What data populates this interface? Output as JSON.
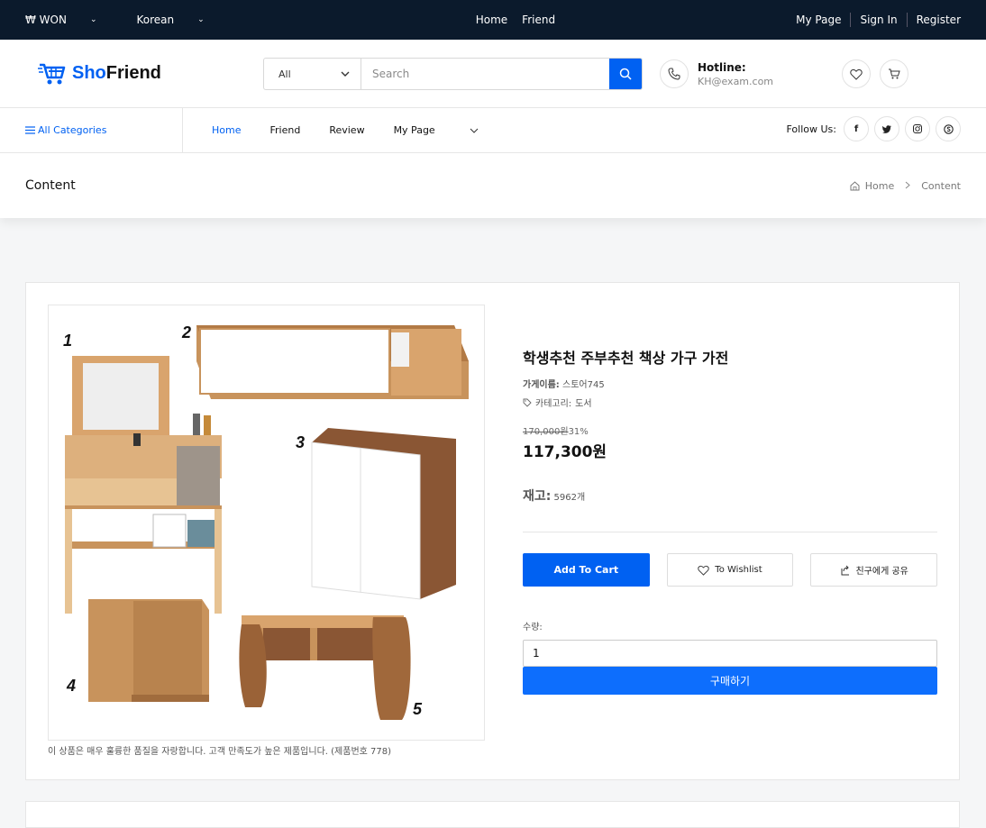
{
  "topbar": {
    "currency": "₩ WON",
    "language": "Korean",
    "center_links": [
      "Home",
      "Friend"
    ],
    "right_links": [
      "My Page",
      "Sign In",
      "Register"
    ]
  },
  "header": {
    "logo_part1": "Sho",
    "logo_part2": "Friend",
    "search_category": "All",
    "search_placeholder": "Search",
    "hotline_label": "Hotline:",
    "hotline_value": "KH@exam.com"
  },
  "nav": {
    "all_categories": "All Categories",
    "links": [
      "Home",
      "Friend",
      "Review",
      "My Page"
    ],
    "follow_label": "Follow Us:",
    "social": [
      "f",
      "t",
      "ig",
      "sk"
    ]
  },
  "breadcrumb": {
    "page_title": "Content",
    "home": "Home",
    "current": "Content"
  },
  "product": {
    "name": "학생추천 주부추천 책상 가구 가전",
    "store_label": "가게이름:",
    "store_value": "스토어745",
    "category_label": "카테고리:",
    "category_value": "도서",
    "old_price": "170,000원",
    "discount": "31%",
    "price": "117,300원",
    "stock_label": "재고:",
    "stock_value": "5962개",
    "add_to_cart": "Add To Cart",
    "wishlist": "To Wishlist",
    "share": "친구에게 공유",
    "qty_label": "수량:",
    "qty_value": "1",
    "buy": "구매하기",
    "description": "이 상품은 매우 훌륭한 품질을 자랑합니다. 고객 만족도가 높은 제품입니다. (제품번호 778)",
    "image_labels": [
      "1",
      "2",
      "3",
      "4",
      "5"
    ]
  },
  "colors": {
    "primary": "#0061f2",
    "topbar": "#0b1a2c"
  }
}
